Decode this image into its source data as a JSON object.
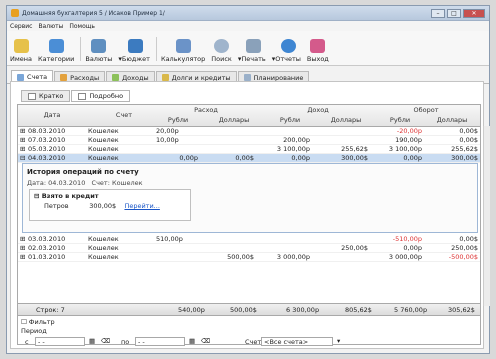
{
  "window": {
    "title": "Домашняя бухгалтерия 5 / Исаков Пример 1/"
  },
  "menu": [
    "Сервис",
    "Валюты",
    "Помощь"
  ],
  "toolbar": {
    "names": "Имена",
    "categories": "Категории",
    "currencies": "Валюты",
    "budget": "Бюджет",
    "calculator": "Калькулятор",
    "search": "Поиск",
    "print": "Печать",
    "reports": "Отчеты",
    "exit": "Выход"
  },
  "tabs": [
    "Счета",
    "Расходы",
    "Доходы",
    "Долги и кредиты",
    "Планирование"
  ],
  "subtabs": [
    "Кратко",
    "Подробно"
  ],
  "headers": {
    "date": "Дата",
    "account": "Счет",
    "expense": "Расход",
    "income": "Доход",
    "turnover": "Оборот",
    "rub": "Рубли",
    "usd": "Доллары"
  },
  "rows_top": [
    {
      "date": "08.03.2010",
      "account": "Кошелек",
      "exp_rub": "20,00р",
      "exp_usd": "",
      "inc_rub": "",
      "inc_usd": "",
      "t_rub": "-20,00р",
      "t_usd": "0,00$"
    },
    {
      "date": "07.03.2010",
      "account": "Кошелек",
      "exp_rub": "10,00р",
      "exp_usd": "",
      "inc_rub": "200,00р",
      "inc_usd": "",
      "t_rub": "190,00р",
      "t_usd": "0,00$"
    },
    {
      "date": "05.03.2010",
      "account": "Кошелек",
      "exp_rub": "",
      "exp_usd": "",
      "inc_rub": "3 100,00р",
      "inc_usd": "255,62$",
      "t_rub": "3 100,00р",
      "t_usd": "255,62$"
    },
    {
      "date": "04.03.2010",
      "account": "Кошелек",
      "exp_rub": "0,00р",
      "exp_usd": "0,00$",
      "inc_rub": "0,00р",
      "inc_usd": "300,00$",
      "t_rub": "0,00р",
      "t_usd": "300,00$"
    }
  ],
  "detail": {
    "title": "История операций по счету",
    "date_label": "Дата:",
    "date": "04.03.2010",
    "account_label": "Счет:",
    "account": "Кошелек",
    "group": "Взято в кредит",
    "person": "Петров",
    "amount": "300,00$",
    "link": "Перейти..."
  },
  "rows_bottom": [
    {
      "date": "03.03.2010",
      "account": "Кошелек",
      "exp_rub": "510,00р",
      "exp_usd": "",
      "inc_rub": "",
      "inc_usd": "",
      "t_rub": "-510,00р",
      "t_usd": "0,00$"
    },
    {
      "date": "02.03.2010",
      "account": "Кошелек",
      "exp_rub": "",
      "exp_usd": "",
      "inc_rub": "",
      "inc_usd": "250,00$",
      "t_rub": "0,00р",
      "t_usd": "250,00$"
    },
    {
      "date": "01.03.2010",
      "account": "Кошелек",
      "exp_rub": "",
      "exp_usd": "500,00$",
      "inc_rub": "3 000,00р",
      "inc_usd": "",
      "t_rub": "3 000,00р",
      "t_usd": "-500,00$"
    }
  ],
  "totals": {
    "label": "Строк: 7",
    "exp_rub": "540,00р",
    "exp_usd": "500,00$",
    "inc_rub": "6 300,00р",
    "inc_usd": "805,62$",
    "t_rub": "5 760,00р",
    "t_usd": "305,62$"
  },
  "filter": {
    "filter_label": "Фильтр",
    "period_label": "Период",
    "from_label": "с",
    "to_label": "по",
    "from_value": "- -",
    "to_value": "- -",
    "account_label": "Счет",
    "account_value": "<Все счета>"
  }
}
